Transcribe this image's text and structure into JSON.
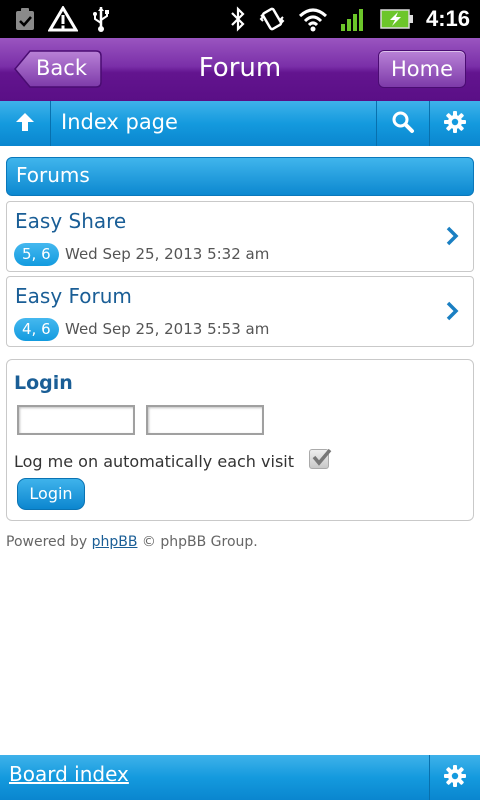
{
  "status_bar": {
    "time": "4:16",
    "icons": [
      "clipboard-check-icon",
      "warning-icon",
      "usb-icon",
      "bluetooth-icon",
      "vibrate-icon",
      "wifi-icon",
      "signal-icon",
      "battery-charging-icon"
    ]
  },
  "header": {
    "title": "Forum",
    "back_label": "Back",
    "home_label": "Home"
  },
  "navbar": {
    "title": "Index page",
    "icons": [
      "up-arrow-icon",
      "search-icon",
      "gear-icon"
    ]
  },
  "forums": {
    "heading": "Forums",
    "items": [
      {
        "name": "Easy Share",
        "badge": "5, 6",
        "date": "Wed Sep 25, 2013 5:32 am"
      },
      {
        "name": "Easy Forum",
        "badge": "4, 6",
        "date": "Wed Sep 25, 2013 5:53 am"
      }
    ]
  },
  "login": {
    "title": "Login",
    "username_value": "",
    "password_value": "",
    "auto_login_label": "Log me on automatically each visit",
    "auto_login_checked": true,
    "button_label": "Login"
  },
  "footer": {
    "powered_prefix": "Powered by",
    "powered_link": "phpBB",
    "powered_suffix": "© phpBB Group."
  },
  "bottom_bar": {
    "board_index_label": "Board index"
  },
  "colors": {
    "header_purple": "#63148f",
    "accent_blue": "#149ade",
    "link_blue": "#1a5e96"
  }
}
